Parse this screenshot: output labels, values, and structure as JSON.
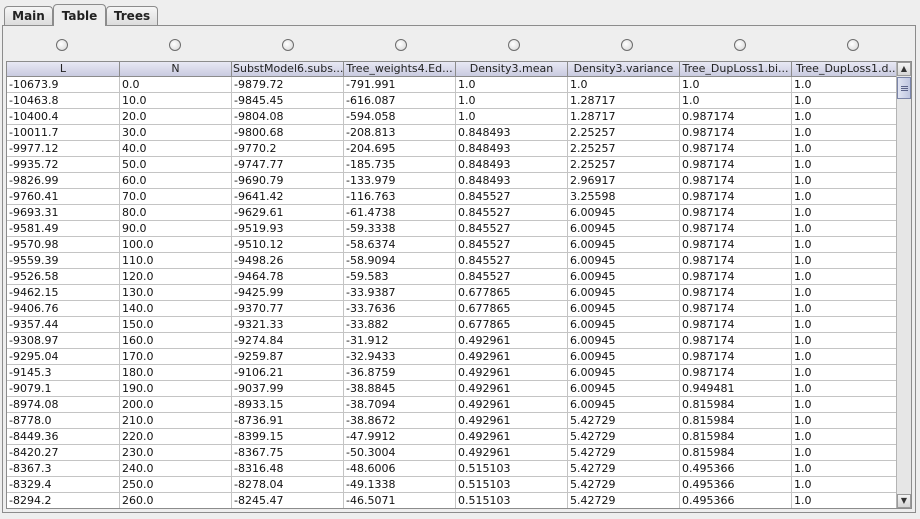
{
  "tabs": [
    {
      "label": "Main",
      "selected": false
    },
    {
      "label": "Table",
      "selected": true
    },
    {
      "label": "Trees",
      "selected": false
    }
  ],
  "table": {
    "columns": [
      "L",
      "N",
      "SubstModel6.subs...",
      "Tree_weights4.Ed...",
      "Density3.mean",
      "Density3.variance",
      "Tree_DupLoss1.bi...",
      "Tree_DupLoss1.d..."
    ],
    "rows": [
      [
        "-10673.9",
        "0.0",
        "-9879.72",
        "-791.991",
        "1.0",
        "1.0",
        "1.0",
        "1.0"
      ],
      [
        "-10463.8",
        "10.0",
        "-9845.45",
        "-616.087",
        "1.0",
        "1.28717",
        "1.0",
        "1.0"
      ],
      [
        "-10400.4",
        "20.0",
        "-9804.08",
        "-594.058",
        "1.0",
        "1.28717",
        "0.987174",
        "1.0"
      ],
      [
        "-10011.7",
        "30.0",
        "-9800.68",
        "-208.813",
        "0.848493",
        "2.25257",
        "0.987174",
        "1.0"
      ],
      [
        "-9977.12",
        "40.0",
        "-9770.2",
        "-204.695",
        "0.848493",
        "2.25257",
        "0.987174",
        "1.0"
      ],
      [
        "-9935.72",
        "50.0",
        "-9747.77",
        "-185.735",
        "0.848493",
        "2.25257",
        "0.987174",
        "1.0"
      ],
      [
        "-9826.99",
        "60.0",
        "-9690.79",
        "-133.979",
        "0.848493",
        "2.96917",
        "0.987174",
        "1.0"
      ],
      [
        "-9760.41",
        "70.0",
        "-9641.42",
        "-116.763",
        "0.845527",
        "3.25598",
        "0.987174",
        "1.0"
      ],
      [
        "-9693.31",
        "80.0",
        "-9629.61",
        "-61.4738",
        "0.845527",
        "6.00945",
        "0.987174",
        "1.0"
      ],
      [
        "-9581.49",
        "90.0",
        "-9519.93",
        "-59.3338",
        "0.845527",
        "6.00945",
        "0.987174",
        "1.0"
      ],
      [
        "-9570.98",
        "100.0",
        "-9510.12",
        "-58.6374",
        "0.845527",
        "6.00945",
        "0.987174",
        "1.0"
      ],
      [
        "-9559.39",
        "110.0",
        "-9498.26",
        "-58.9094",
        "0.845527",
        "6.00945",
        "0.987174",
        "1.0"
      ],
      [
        "-9526.58",
        "120.0",
        "-9464.78",
        "-59.583",
        "0.845527",
        "6.00945",
        "0.987174",
        "1.0"
      ],
      [
        "-9462.15",
        "130.0",
        "-9425.99",
        "-33.9387",
        "0.677865",
        "6.00945",
        "0.987174",
        "1.0"
      ],
      [
        "-9406.76",
        "140.0",
        "-9370.77",
        "-33.7636",
        "0.677865",
        "6.00945",
        "0.987174",
        "1.0"
      ],
      [
        "-9357.44",
        "150.0",
        "-9321.33",
        "-33.882",
        "0.677865",
        "6.00945",
        "0.987174",
        "1.0"
      ],
      [
        "-9308.97",
        "160.0",
        "-9274.84",
        "-31.912",
        "0.492961",
        "6.00945",
        "0.987174",
        "1.0"
      ],
      [
        "-9295.04",
        "170.0",
        "-9259.87",
        "-32.9433",
        "0.492961",
        "6.00945",
        "0.987174",
        "1.0"
      ],
      [
        "-9145.3",
        "180.0",
        "-9106.21",
        "-36.8759",
        "0.492961",
        "6.00945",
        "0.987174",
        "1.0"
      ],
      [
        "-9079.1",
        "190.0",
        "-9037.99",
        "-38.8845",
        "0.492961",
        "6.00945",
        "0.949481",
        "1.0"
      ],
      [
        "-8974.08",
        "200.0",
        "-8933.15",
        "-38.7094",
        "0.492961",
        "6.00945",
        "0.815984",
        "1.0"
      ],
      [
        "-8778.0",
        "210.0",
        "-8736.91",
        "-38.8672",
        "0.492961",
        "5.42729",
        "0.815984",
        "1.0"
      ],
      [
        "-8449.36",
        "220.0",
        "-8399.15",
        "-47.9912",
        "0.492961",
        "5.42729",
        "0.815984",
        "1.0"
      ],
      [
        "-8420.27",
        "230.0",
        "-8367.75",
        "-50.3004",
        "0.492961",
        "5.42729",
        "0.815984",
        "1.0"
      ],
      [
        "-8367.3",
        "240.0",
        "-8316.48",
        "-48.6006",
        "0.515103",
        "5.42729",
        "0.495366",
        "1.0"
      ],
      [
        "-8329.4",
        "250.0",
        "-8278.04",
        "-49.1338",
        "0.515103",
        "5.42729",
        "0.495366",
        "1.0"
      ],
      [
        "-8294.2",
        "260.0",
        "-8245.47",
        "-46.5071",
        "0.515103",
        "5.42729",
        "0.495366",
        "1.0"
      ]
    ]
  },
  "scrollbar": {
    "up_icon": "scroll-up-arrow",
    "down_icon": "scroll-down-arrow"
  }
}
